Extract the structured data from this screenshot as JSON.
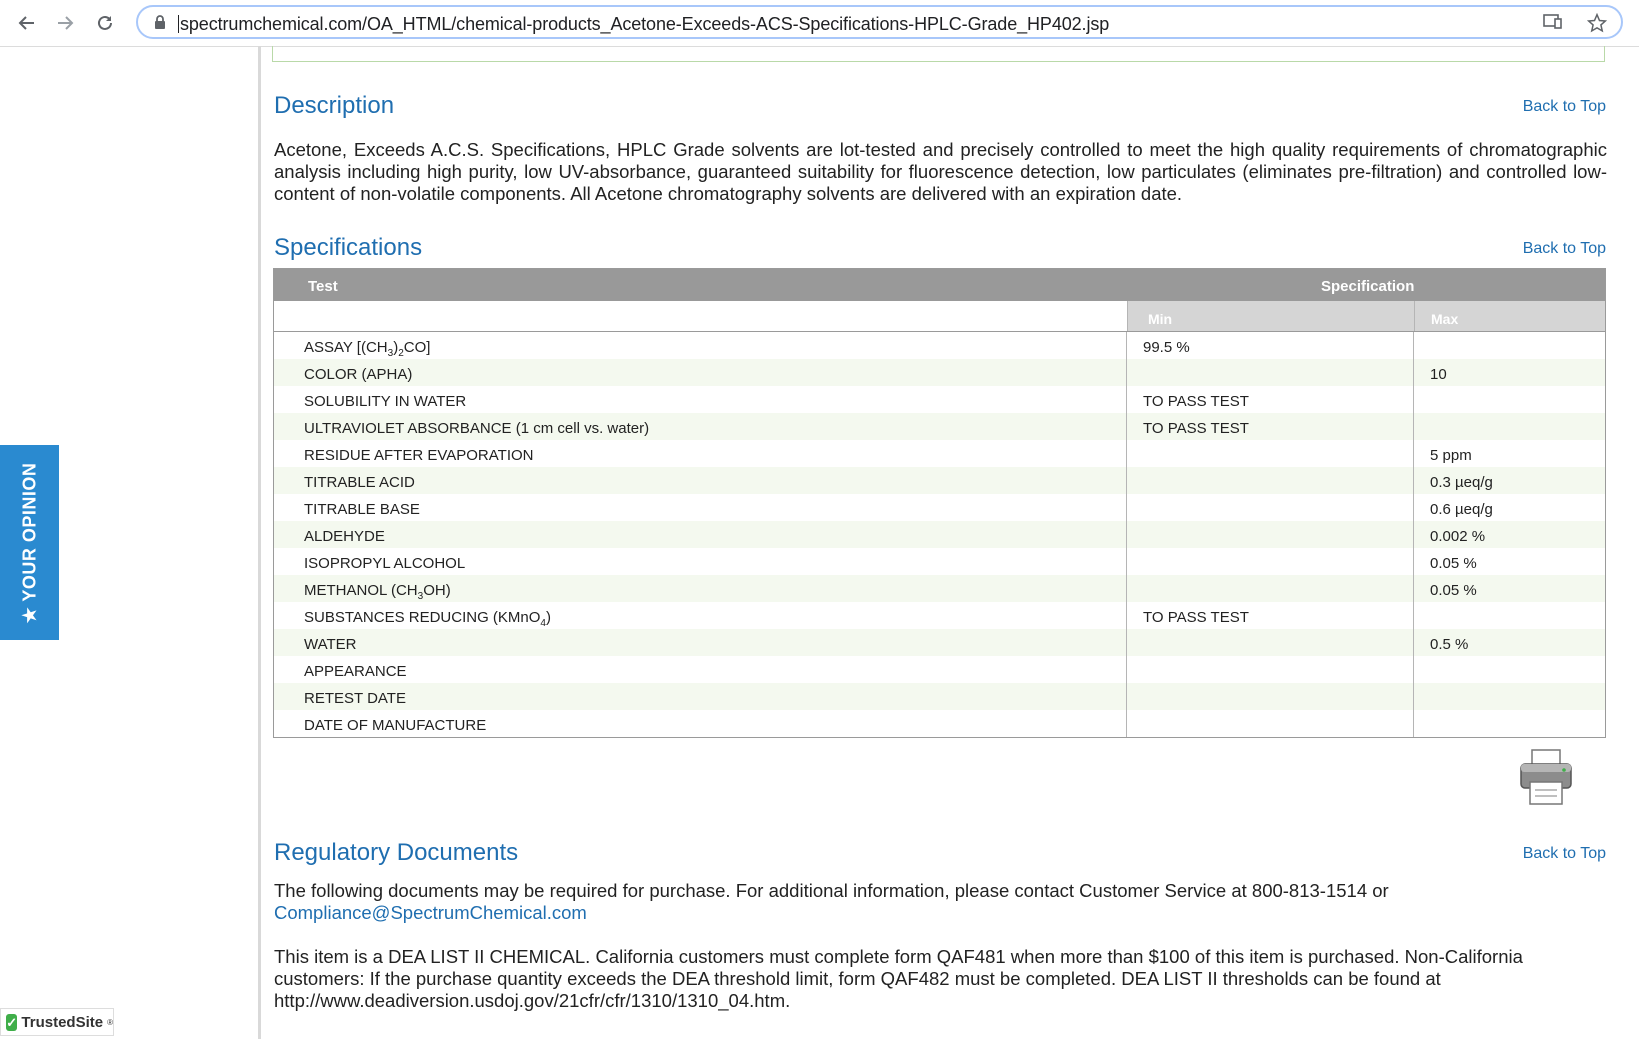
{
  "browser": {
    "url": "spectrumchemical.com/OA_HTML/chemical-products_Acetone-Exceeds-ACS-Specifications-HPLC-Grade_HP402.jsp"
  },
  "opinion_tab": "★ YOUR OPINION",
  "trusted_site": "TrustedSite",
  "back_to_top": "Back to Top",
  "description": {
    "title": "Description",
    "text": "Acetone, Exceeds A.C.S. Specifications, HPLC Grade solvents are lot-tested and precisely controlled to meet the high quality requirements of chromatographic analysis including high purity, low UV-absorbance, guaranteed suitability for fluorescence detection, low particulates (eliminates pre-filtration) and controlled low-content of non-volatile components. All Acetone chromatography solvents are delivered with an expiration date."
  },
  "specifications": {
    "title": "Specifications",
    "header_test": "Test",
    "header_spec": "Specification",
    "header_min": "Min",
    "header_max": "Max",
    "rows": [
      {
        "test": "ASSAY [(CH3)2CO]",
        "min": "99.5 %",
        "max": ""
      },
      {
        "test": "COLOR (APHA)",
        "min": "",
        "max": "10"
      },
      {
        "test": "SOLUBILITY IN WATER",
        "min": "TO PASS TEST",
        "max": ""
      },
      {
        "test": "ULTRAVIOLET ABSORBANCE (1 cm cell vs. water)",
        "min": "TO PASS TEST",
        "max": ""
      },
      {
        "test": "RESIDUE AFTER EVAPORATION",
        "min": "",
        "max": "5 ppm"
      },
      {
        "test": "TITRABLE ACID",
        "min": "",
        "max": "0.3 µeq/g"
      },
      {
        "test": "TITRABLE BASE",
        "min": "",
        "max": "0.6 µeq/g"
      },
      {
        "test": "ALDEHYDE",
        "min": "",
        "max": "0.002 %"
      },
      {
        "test": "ISOPROPYL ALCOHOL",
        "min": "",
        "max": "0.05 %"
      },
      {
        "test": "METHANOL (CH3OH)",
        "min": "",
        "max": "0.05 %"
      },
      {
        "test": "SUBSTANCES REDUCING (KMnO4)",
        "min": "TO PASS TEST",
        "max": ""
      },
      {
        "test": "WATER",
        "min": "",
        "max": "0.5 %"
      },
      {
        "test": "APPEARANCE",
        "min": "",
        "max": ""
      },
      {
        "test": "RETEST DATE",
        "min": "",
        "max": ""
      },
      {
        "test": "DATE OF MANUFACTURE",
        "min": "",
        "max": ""
      }
    ]
  },
  "regulatory": {
    "title": "Regulatory Documents",
    "intro": "The following documents may be required for purchase. For additional information, please contact Customer Service at 800-813-1514 or",
    "email": "Compliance@SpectrumChemical.com",
    "dea_text": "This item is a DEA LIST II CHEMICAL. California customers must complete form QAF481 when more than $100 of this item is purchased. Non-California customers: If the purchase quantity exceeds the DEA threshold limit, form QAF482 must be completed. DEA LIST II thresholds can be found at http://www.deadiversion.usdoj.gov/21cfr/cfr/1310/1310_04.htm."
  }
}
